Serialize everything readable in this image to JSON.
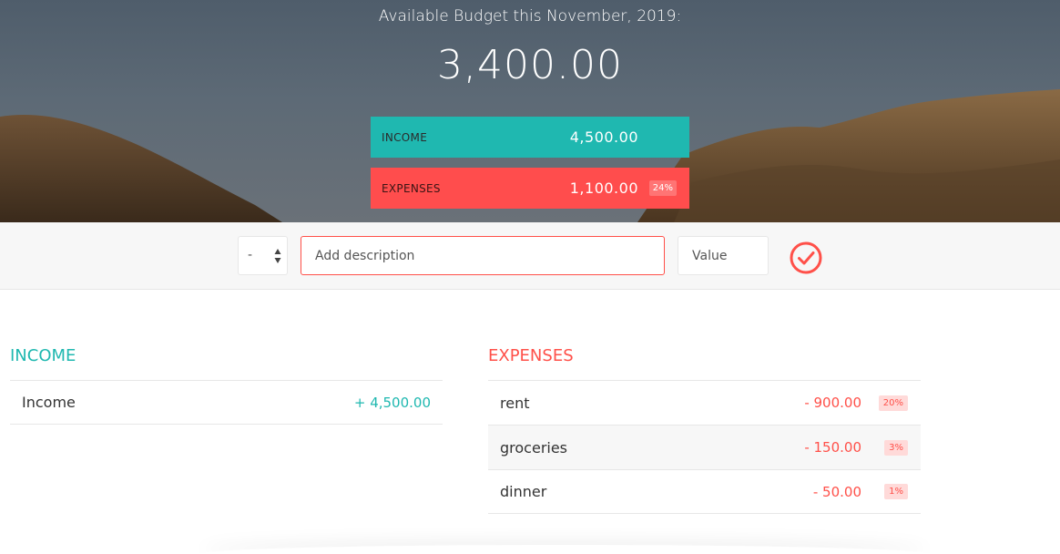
{
  "header": {
    "title": "Available Budget this November, 2019:",
    "budget_value": "3,400.00",
    "income": {
      "label": "INCOME",
      "value": "4,500.00"
    },
    "expenses": {
      "label": "EXPENSES",
      "value": "1,100.00",
      "percentage": "24%"
    }
  },
  "add_form": {
    "type_selected": "-",
    "description_placeholder": "Add description",
    "value_placeholder": "Value",
    "add_icon": "check-circle-icon"
  },
  "income_list": {
    "title": "INCOME",
    "items": [
      {
        "description": "Income",
        "value": "+ 4,500.00"
      }
    ]
  },
  "expenses_list": {
    "title": "EXPENSES",
    "items": [
      {
        "description": "rent",
        "value": "- 900.00",
        "percentage": "20%"
      },
      {
        "description": "groceries",
        "value": "- 150.00",
        "percentage": "3%"
      },
      {
        "description": "dinner",
        "value": "- 50.00",
        "percentage": "1%"
      }
    ]
  },
  "colors": {
    "income": "#1fb8b0",
    "expense": "#ff5049",
    "expense_box": "#ff4d4d"
  }
}
